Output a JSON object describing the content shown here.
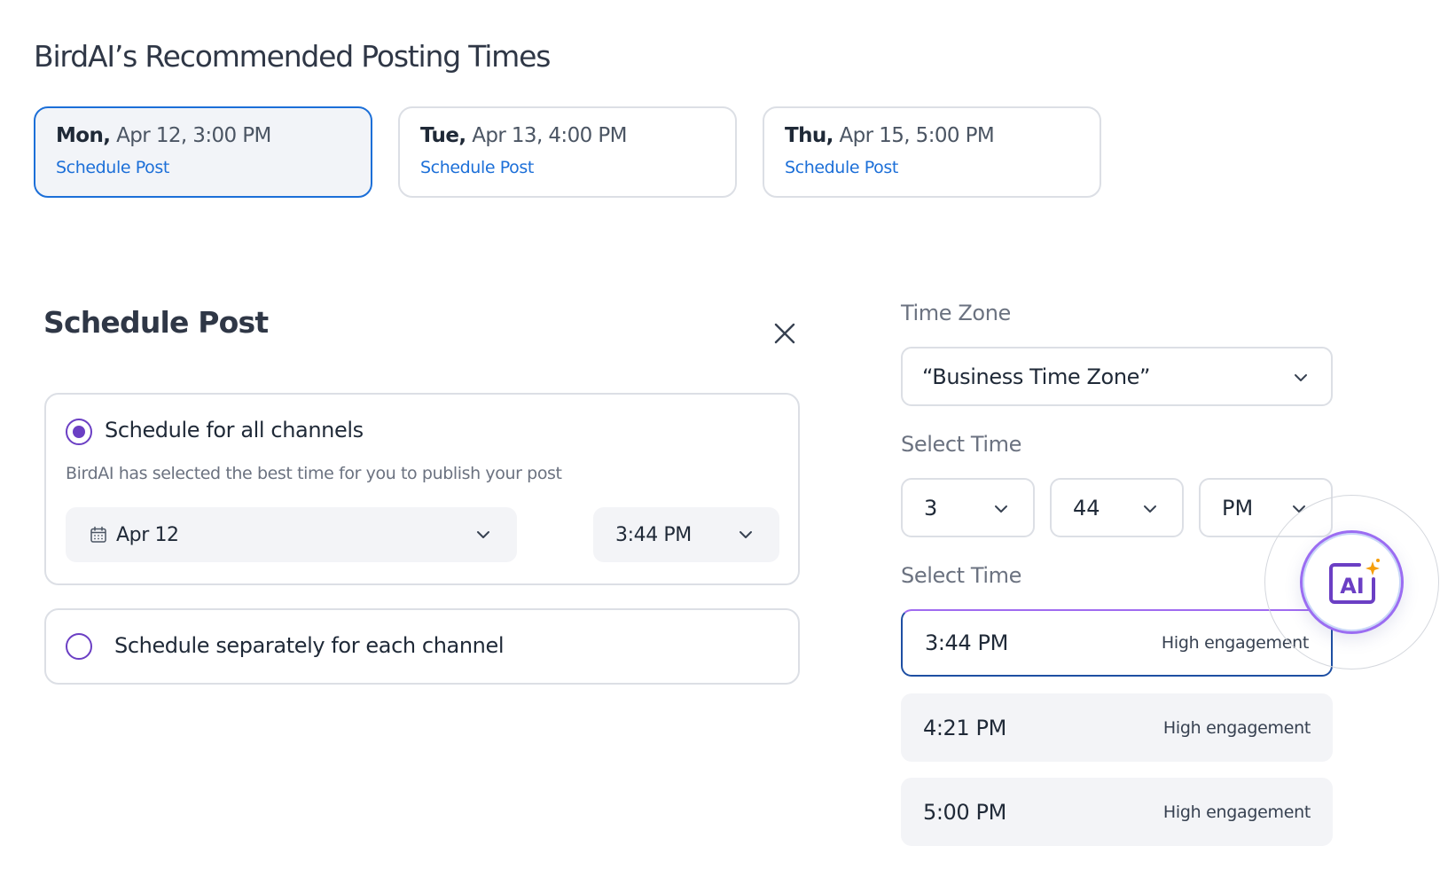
{
  "recommended": {
    "title": "BirdAI’s Recommended Posting Times",
    "cards": [
      {
        "day": "Mon,",
        "datetime": " Apr 12, 3:00 PM",
        "action": "Schedule Post"
      },
      {
        "day": "Tue,",
        "datetime": " Apr 13, 4:00 PM",
        "action": "Schedule Post"
      },
      {
        "day": "Thu,",
        "datetime": " Apr 15, 5:00 PM",
        "action": "Schedule Post"
      }
    ]
  },
  "schedule": {
    "title": "Schedule Post",
    "option_all": {
      "label": "Schedule for all channels",
      "description": "BirdAI has selected the best time for you to publish your post",
      "date_value": "Apr 12",
      "time_value": "3:44 PM"
    },
    "option_separate": {
      "label": "Schedule separately for each channel"
    }
  },
  "right": {
    "timezone_label": "Time Zone",
    "timezone_value": "“Business Time Zone”",
    "select_time_label": "Select Time",
    "hour": "3",
    "minute": "44",
    "meridiem": "PM",
    "suggest_label": "Select Time",
    "slots": [
      {
        "time": "3:44 PM",
        "engagement": "High engagement"
      },
      {
        "time": "4:21 PM",
        "engagement": "High engagement"
      },
      {
        "time": "5:00 PM",
        "engagement": "High engagement"
      }
    ],
    "ai_badge_text": "AI"
  },
  "colors": {
    "accent_blue": "#1c6fd8",
    "accent_purple": "#6b3fc4"
  }
}
